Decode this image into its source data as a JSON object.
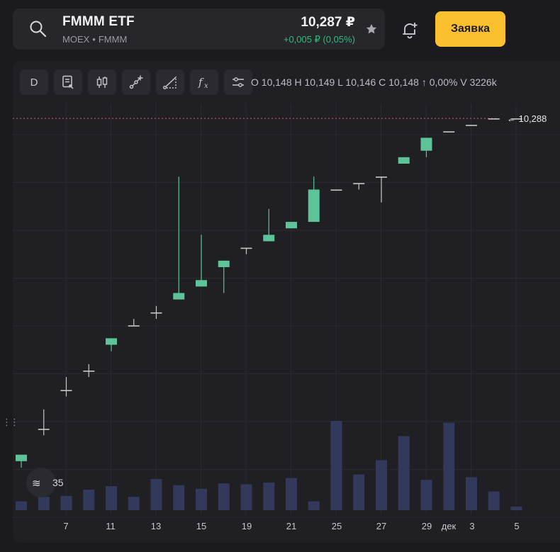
{
  "header": {
    "name": "FMMM ETF",
    "exchange": "MOEX",
    "separator": "•",
    "ticker": "FMMM",
    "price": "10,287 ₽",
    "change": "+0,005 ₽ (0,05%)",
    "order_label": "Заявка"
  },
  "toolbar": {
    "interval_label": "D",
    "ohlc": {
      "o_label": "O",
      "o": "10,148",
      "h_label": "H",
      "h": "10,149",
      "l_label": "L",
      "l": "10,146",
      "c_label": "C",
      "c": "10,148",
      "change": "↑ 0,00%",
      "v_label": "V",
      "v": "3226k"
    }
  },
  "colors": {
    "up": "#5fc39a",
    "down": "#e05a5a",
    "flat": "#c8c8c8",
    "volume": "#33395a",
    "accent": "#fbc02d",
    "last_price_line": "#e05a5a"
  },
  "chart_data": {
    "type": "candlestick",
    "last_price_label": "10,288",
    "left_price_label_partial": "35",
    "x_ticks": [
      "7",
      "11",
      "13",
      "15",
      "19",
      "21",
      "25",
      "27",
      "29",
      "дек",
      "3",
      "5"
    ],
    "candles": [
      {
        "o": 10.235,
        "h": 10.236,
        "l": 10.234,
        "c": 10.236,
        "v": 0.1
      },
      {
        "o": 10.24,
        "h": 10.243,
        "l": 10.239,
        "c": 10.24,
        "v": 0.15
      },
      {
        "o": 10.246,
        "h": 10.248,
        "l": 10.245,
        "c": 10.246,
        "v": 0.16
      },
      {
        "o": 10.249,
        "h": 10.25,
        "l": 10.248,
        "c": 10.249,
        "v": 0.23
      },
      {
        "o": 10.253,
        "h": 10.254,
        "l": 10.252,
        "c": 10.254,
        "v": 0.27
      },
      {
        "o": 10.256,
        "h": 10.257,
        "l": 10.256,
        "c": 10.256,
        "v": 0.15
      },
      {
        "o": 10.258,
        "h": 10.259,
        "l": 10.257,
        "c": 10.258,
        "v": 0.35
      },
      {
        "o": 10.26,
        "h": 10.279,
        "l": 10.26,
        "c": 10.261,
        "v": 0.28
      },
      {
        "o": 10.262,
        "h": 10.27,
        "l": 10.262,
        "c": 10.263,
        "v": 0.24
      },
      {
        "o": 10.265,
        "h": 10.266,
        "l": 10.261,
        "c": 10.266,
        "v": 0.3
      },
      {
        "o": 10.268,
        "h": 10.268,
        "l": 10.267,
        "c": 10.268,
        "v": 0.29
      },
      {
        "o": 10.269,
        "h": 10.274,
        "l": 10.269,
        "c": 10.27,
        "v": 0.31
      },
      {
        "o": 10.271,
        "h": 10.272,
        "l": 10.271,
        "c": 10.272,
        "v": 0.36
      },
      {
        "o": 10.272,
        "h": 10.279,
        "l": 10.272,
        "c": 10.277,
        "v": 0.1
      },
      {
        "o": 10.277,
        "h": 10.277,
        "l": 10.277,
        "c": 10.277,
        "v": 1.0
      },
      {
        "o": 10.278,
        "h": 10.278,
        "l": 10.277,
        "c": 10.278,
        "v": 0.4
      },
      {
        "o": 10.279,
        "h": 10.279,
        "l": 10.275,
        "c": 10.279,
        "v": 0.56
      },
      {
        "o": 10.281,
        "h": 10.282,
        "l": 10.281,
        "c": 10.282,
        "v": 0.83
      },
      {
        "o": 10.283,
        "h": 10.285,
        "l": 10.282,
        "c": 10.285,
        "v": 0.34
      },
      {
        "o": 10.286,
        "h": 10.286,
        "l": 10.286,
        "c": 10.286,
        "v": 0.98
      },
      {
        "o": 10.287,
        "h": 10.287,
        "l": 10.287,
        "c": 10.287,
        "v": 0.37
      },
      {
        "o": 10.288,
        "h": 10.288,
        "l": 10.288,
        "c": 10.288,
        "v": 0.21
      },
      {
        "o": 10.288,
        "h": 10.288,
        "l": 10.288,
        "c": 10.288,
        "v": 0.04
      }
    ]
  }
}
